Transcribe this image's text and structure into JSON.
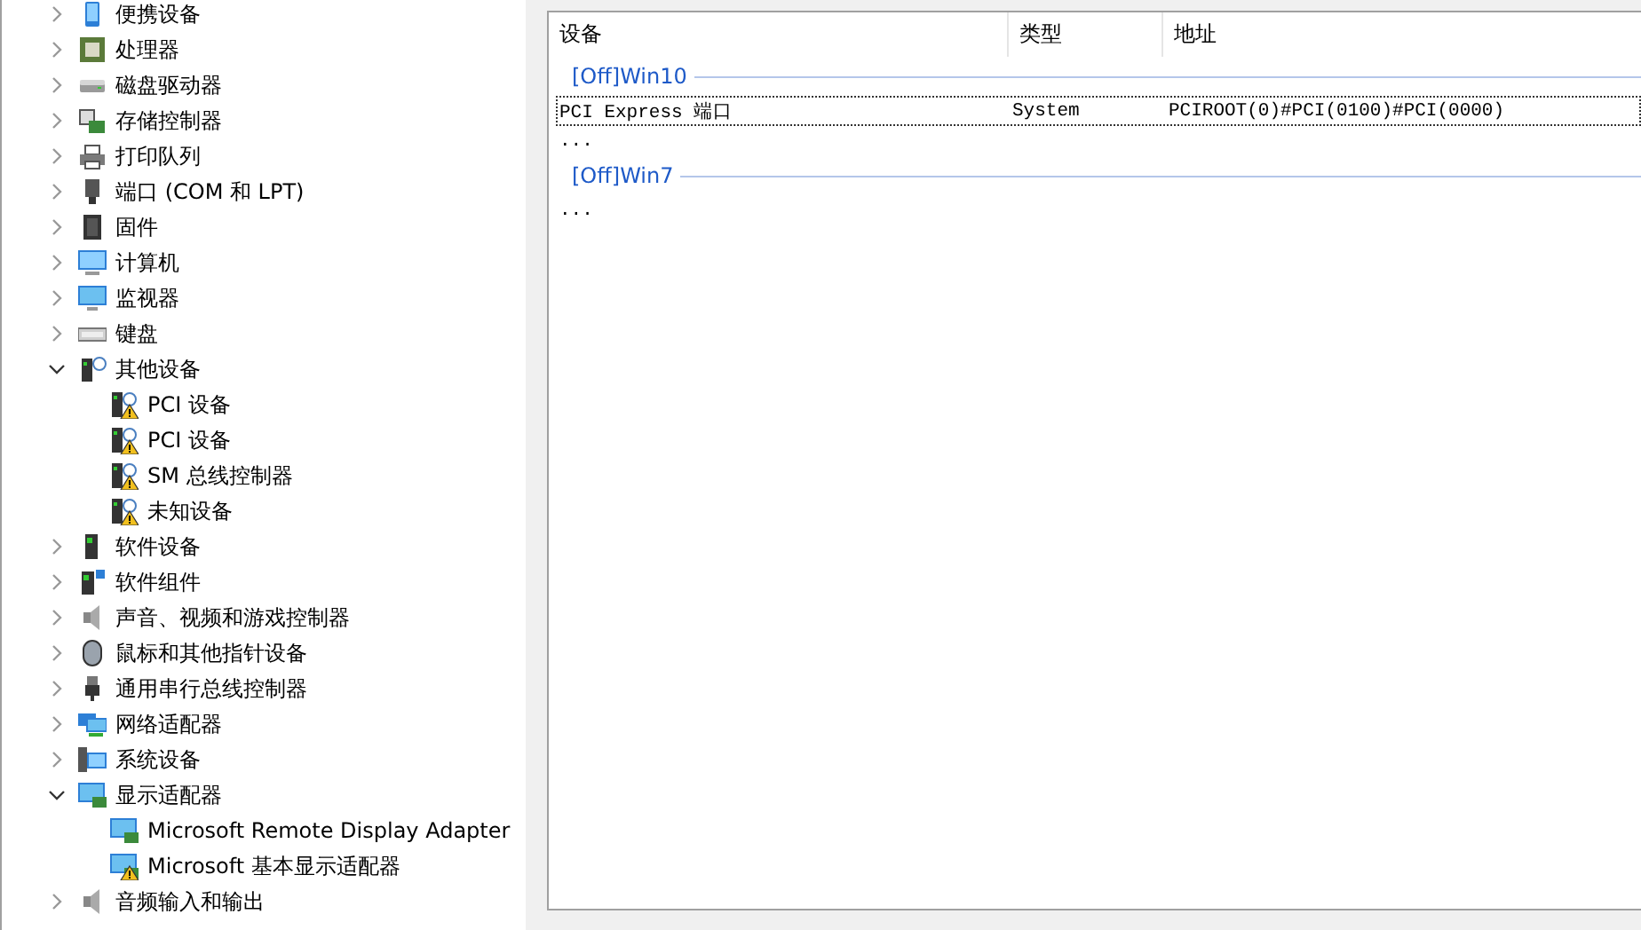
{
  "device_tree": {
    "items": [
      {
        "label": "便携设备",
        "kind": "portable",
        "expanded": false
      },
      {
        "label": "处理器",
        "kind": "processor",
        "expanded": false
      },
      {
        "label": "磁盘驱动器",
        "kind": "disk",
        "expanded": false
      },
      {
        "label": "存储控制器",
        "kind": "storage",
        "expanded": false
      },
      {
        "label": "打印队列",
        "kind": "printer",
        "expanded": false
      },
      {
        "label": "端口 (COM 和 LPT)",
        "kind": "port",
        "expanded": false
      },
      {
        "label": "固件",
        "kind": "firmware",
        "expanded": false
      },
      {
        "label": "计算机",
        "kind": "computer",
        "expanded": false
      },
      {
        "label": "监视器",
        "kind": "monitor",
        "expanded": false
      },
      {
        "label": "键盘",
        "kind": "keyboard",
        "expanded": false
      },
      {
        "label": "其他设备",
        "kind": "other",
        "expanded": true,
        "children": [
          {
            "label": "PCI 设备",
            "kind": "unknown",
            "warning": true
          },
          {
            "label": "PCI 设备",
            "kind": "unknown",
            "warning": true
          },
          {
            "label": "SM 总线控制器",
            "kind": "unknown",
            "warning": true
          },
          {
            "label": "未知设备",
            "kind": "unknown",
            "warning": true
          }
        ]
      },
      {
        "label": "软件设备",
        "kind": "software",
        "expanded": false
      },
      {
        "label": "软件组件",
        "kind": "component",
        "expanded": false
      },
      {
        "label": "声音、视频和游戏控制器",
        "kind": "sound",
        "expanded": false
      },
      {
        "label": "鼠标和其他指针设备",
        "kind": "mouse",
        "expanded": false
      },
      {
        "label": "通用串行总线控制器",
        "kind": "usb",
        "expanded": false
      },
      {
        "label": "网络适配器",
        "kind": "network",
        "expanded": false
      },
      {
        "label": "系统设备",
        "kind": "system",
        "expanded": false
      },
      {
        "label": "显示适配器",
        "kind": "display",
        "expanded": true,
        "children": [
          {
            "label": "Microsoft Remote Display Adapter",
            "kind": "display",
            "warning": false
          },
          {
            "label": "Microsoft 基本显示适配器",
            "kind": "display",
            "warning": true
          }
        ]
      },
      {
        "label": "音频输入和输出",
        "kind": "sound",
        "expanded": false
      }
    ]
  },
  "device_list": {
    "columns": [
      "设备",
      "类型",
      "地址"
    ],
    "groups": [
      {
        "title": "[Off]Win10",
        "rows": [
          {
            "cells": [
              "PCI Express 端口",
              "System",
              "PCIROOT(0)#PCI(0100)#PCI(0000)"
            ],
            "focused": true
          },
          {
            "cells": [
              "..."
            ],
            "focused": false
          }
        ]
      },
      {
        "title": "[Off]Win7",
        "rows": [
          {
            "cells": [
              "..."
            ],
            "focused": false
          }
        ]
      }
    ]
  }
}
